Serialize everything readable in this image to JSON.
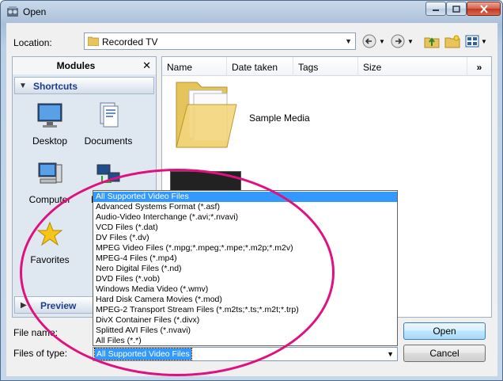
{
  "window": {
    "title": "Open"
  },
  "location": {
    "label": "Location:",
    "value": "Recorded TV"
  },
  "modules": {
    "title": "Modules",
    "shortcuts_label": "Shortcuts",
    "items": [
      "Desktop",
      "Documents",
      "Computer",
      "Network",
      "Favorites"
    ],
    "preview_label": "Preview"
  },
  "columns": [
    "Name",
    "Date taken",
    "Tags",
    "Size"
  ],
  "files": [
    {
      "name": "Sample Media"
    }
  ],
  "form": {
    "file_name_label": "File name:",
    "file_type_label": "Files of type:",
    "file_type_value": "All Supported Video Files"
  },
  "buttons": {
    "open": "Open",
    "cancel": "Cancel"
  },
  "type_options": [
    "All Supported Video Files",
    "Advanced Systems Format (*.asf)",
    "Audio-Video Interchange (*.avi;*.nvavi)",
    "VCD Files (*.dat)",
    "DV Files (*.dv)",
    "MPEG Video Files (*.mpg;*.mpeg;*.mpe;*.m2p;*.m2v)",
    "MPEG-4 Files (*.mp4)",
    "Nero Digital Files (*.nd)",
    "DVD Files (*.vob)",
    "Windows Media Video (*.wmv)",
    "Hard Disk Camera Movies (*.mod)",
    "MPEG-2 Transport Stream Files (*.m2ts;*.ts;*.m2t;*.trp)",
    "DivX Container Files (*.divx)",
    "Splitted AVI Files (*.nvavi)",
    "All Files (*.*)"
  ],
  "colors": {
    "selection": "#3399ff",
    "annotation": "#e0117f"
  }
}
